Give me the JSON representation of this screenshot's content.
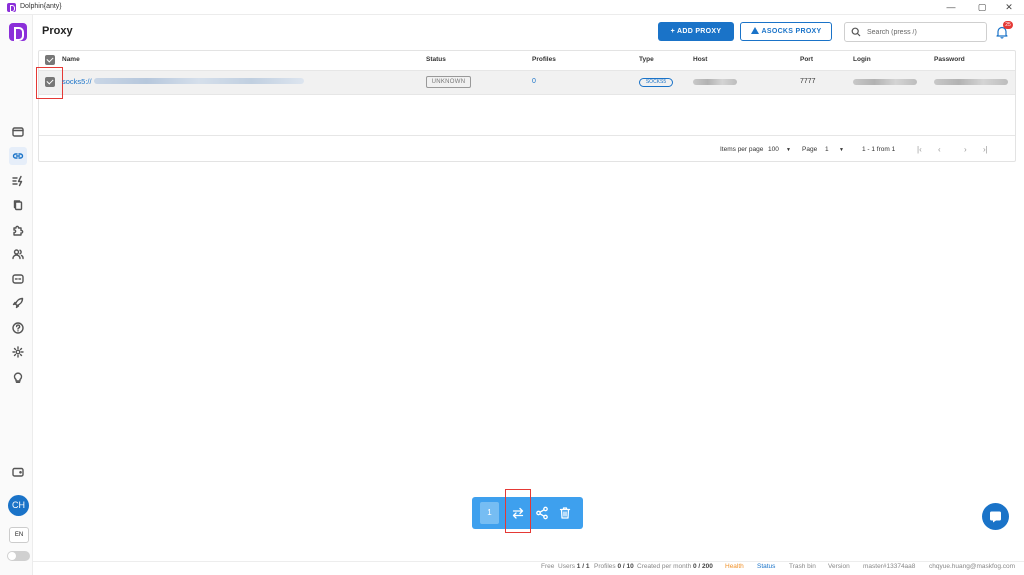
{
  "window": {
    "title": "Dolphin{anty}",
    "minimize": "—",
    "maximize": "▢",
    "close": "✕"
  },
  "page": {
    "title": "Proxy"
  },
  "header": {
    "add_proxy_label": "+ ADD PROXY",
    "asocks_label": "ASOCKS PROXY",
    "search_placeholder": "Search (press /)",
    "notifications_count": "25"
  },
  "table": {
    "columns": [
      "Name",
      "Status",
      "Profiles",
      "Type",
      "Host",
      "Port",
      "Login",
      "Password"
    ],
    "rows": [
      {
        "name": "socks5://",
        "status": "UNKNOWN",
        "profiles": "0",
        "type": "SOCKS5",
        "host": "",
        "port": "7777",
        "login": "",
        "password": ""
      }
    ]
  },
  "pagination": {
    "items_per_page_label": "Items per page",
    "items_per_page": "100",
    "page_label": "Page",
    "page": "1",
    "range": "1 - 1 from 1"
  },
  "bulk": {
    "selected_count": "1"
  },
  "sidebar": {
    "avatar_initials": "CH",
    "language": "EN"
  },
  "footer": {
    "plan": "Free",
    "users_label": "Users",
    "users_value": "1 / 1",
    "profiles_label": "Profiles",
    "profiles_value": "0 / 10",
    "created_label": "Created per month",
    "created_value": "0 / 200",
    "health": "Health",
    "status": "Status",
    "trash": "Trash bin",
    "version": "Version",
    "build": "master#13374aa8",
    "email": "chqyue.huang@maskfog.com"
  },
  "colors": {
    "accent": "#1a73c8",
    "brand": "#8b2fd9",
    "highlight": "#e53935"
  }
}
